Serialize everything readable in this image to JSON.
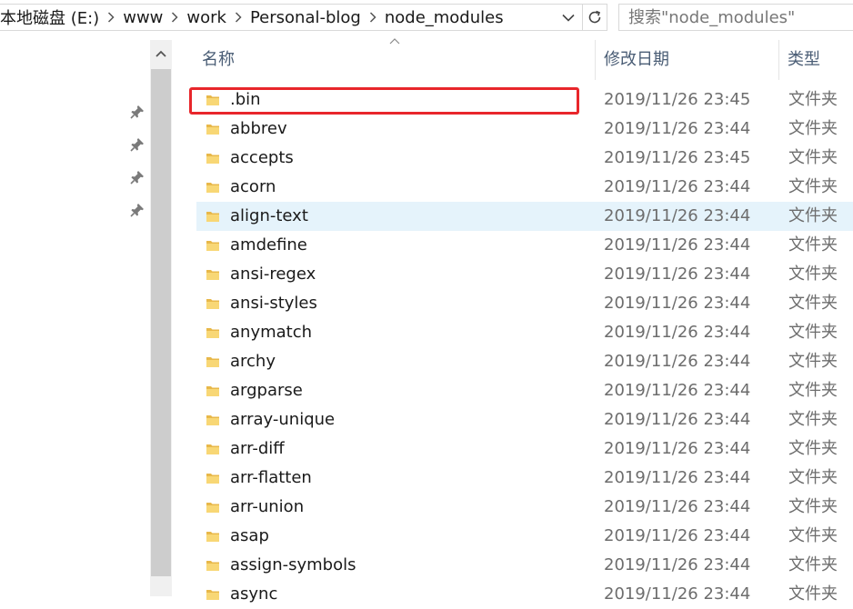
{
  "breadcrumb": {
    "items": [
      "本地磁盘 (E:)",
      "www",
      "work",
      "Personal-blog",
      "node_modules"
    ]
  },
  "search": {
    "placeholder": "搜索\"node_modules\""
  },
  "columns": {
    "name": "名称",
    "date": "修改日期",
    "type": "类型"
  },
  "rows": [
    {
      "name": ".bin",
      "date": "2019/11/26 23:45",
      "type": "文件夹"
    },
    {
      "name": "abbrev",
      "date": "2019/11/26 23:44",
      "type": "文件夹"
    },
    {
      "name": "accepts",
      "date": "2019/11/26 23:45",
      "type": "文件夹"
    },
    {
      "name": "acorn",
      "date": "2019/11/26 23:44",
      "type": "文件夹"
    },
    {
      "name": "align-text",
      "date": "2019/11/26 23:44",
      "type": "文件夹"
    },
    {
      "name": "amdefine",
      "date": "2019/11/26 23:44",
      "type": "文件夹"
    },
    {
      "name": "ansi-regex",
      "date": "2019/11/26 23:44",
      "type": "文件夹"
    },
    {
      "name": "ansi-styles",
      "date": "2019/11/26 23:44",
      "type": "文件夹"
    },
    {
      "name": "anymatch",
      "date": "2019/11/26 23:44",
      "type": "文件夹"
    },
    {
      "name": "archy",
      "date": "2019/11/26 23:44",
      "type": "文件夹"
    },
    {
      "name": "argparse",
      "date": "2019/11/26 23:44",
      "type": "文件夹"
    },
    {
      "name": "array-unique",
      "date": "2019/11/26 23:44",
      "type": "文件夹"
    },
    {
      "name": "arr-diff",
      "date": "2019/11/26 23:44",
      "type": "文件夹"
    },
    {
      "name": "arr-flatten",
      "date": "2019/11/26 23:44",
      "type": "文件夹"
    },
    {
      "name": "arr-union",
      "date": "2019/11/26 23:44",
      "type": "文件夹"
    },
    {
      "name": "asap",
      "date": "2019/11/26 23:44",
      "type": "文件夹"
    },
    {
      "name": "assign-symbols",
      "date": "2019/11/26 23:44",
      "type": "文件夹"
    },
    {
      "name": "async",
      "date": "2019/11/26 23:44",
      "type": "文件夹"
    }
  ],
  "hovered_row": "align-text",
  "highlighted_row": ".bin",
  "colors": {
    "highlight_border": "#e8262b",
    "hover_bg": "#e5f3fb",
    "folder": "#f8d775"
  },
  "icons": {
    "folder": "folder-icon",
    "pin": "pin-icon",
    "refresh": "refresh-icon",
    "dropdown": "chevron-down-icon"
  }
}
